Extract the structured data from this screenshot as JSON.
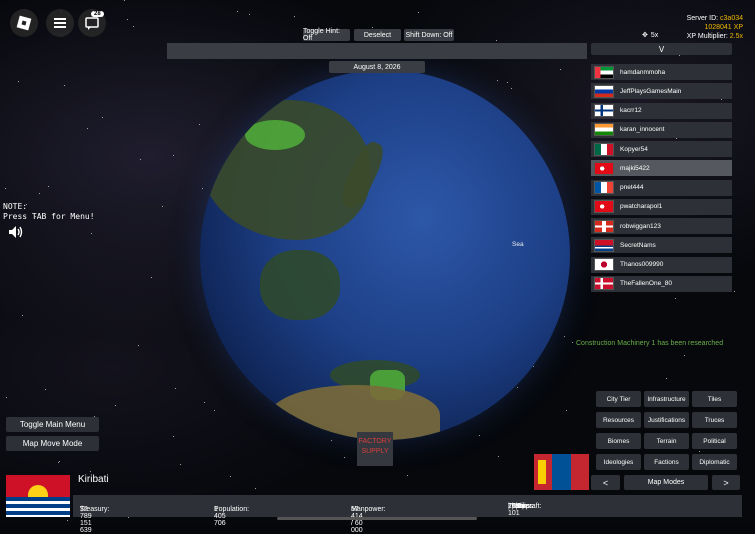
{
  "top": {
    "chat_badge": "28",
    "toggle_hint": "Toggle Hint: Off",
    "deselect": "Deselect",
    "shift_down": "Shift Down: Off",
    "zoom": "5x",
    "v_label": "V",
    "date": "August 8, 2026"
  },
  "server": {
    "id_label": "Server ID:",
    "id_value": "c3a034",
    "xp": "1028041 XP",
    "xp_mult_label": "XP Multiplier:",
    "xp_mult_value": "2.5x"
  },
  "players": [
    {
      "name": "hamdanmmoha",
      "flag": "uae"
    },
    {
      "name": "JeffPlaysGamesMain",
      "flag": "russia"
    },
    {
      "name": "kacrr12",
      "flag": "finland"
    },
    {
      "name": "karan_innocent",
      "flag": "india"
    },
    {
      "name": "Kopyer54",
      "flag": "mexico"
    },
    {
      "name": "majki5422",
      "flag": "turkey"
    },
    {
      "name": "pnet444",
      "flag": "france"
    },
    {
      "name": "pwatcharapol1",
      "flag": "turkey"
    },
    {
      "name": "robwiggan123",
      "flag": "switzerland"
    },
    {
      "name": "SecretNams",
      "flag": "kiribati"
    },
    {
      "name": "Thanos009990",
      "flag": "japan"
    },
    {
      "name": "TheFallenOne_80",
      "flag": "denmark"
    }
  ],
  "map_labels": {
    "sea": "Sea"
  },
  "note": {
    "line1": "NOTE:",
    "line2": "Press TAB for Menu!"
  },
  "research_msg": "Construction Machinery 1 has been researched",
  "left_buttons": {
    "toggle_menu": "Toggle Main Menu",
    "map_move": "Map Move Mode"
  },
  "factory": {
    "line1": "FACTORY",
    "line2": "SUPPLY"
  },
  "action_buttons": [
    [
      "City Tier",
      "Infrastructure",
      "Tiles"
    ],
    [
      "Resources",
      "Justifications",
      "Truces"
    ],
    [
      "Biomes",
      "Terrain",
      "Political"
    ],
    [
      "Ideologies",
      "Factions",
      "Diplomatic"
    ]
  ],
  "map_modes": {
    "prev": "<",
    "label": "Map Modes",
    "next": ">"
  },
  "country": {
    "name": "Kiribati",
    "treasury_label": "Treasury:",
    "treasury": "$2 789 151 639",
    "population_label": "Population:",
    "population": "1 405 706",
    "manpower_label": "Manpower:",
    "manpower": "57 414 / 60 000",
    "troops_label": "Troops:",
    "troops": "29 101",
    "tanks_label": "Tanks:",
    "tanks": "0",
    "ships_label": "Ships:",
    "ships": "0",
    "aircraft_label": "Aircraft:",
    "aircraft": "0"
  },
  "colors": {
    "panel": "#2d3036",
    "accent_gold": "#f0b800",
    "research_green": "#6ab04c"
  }
}
